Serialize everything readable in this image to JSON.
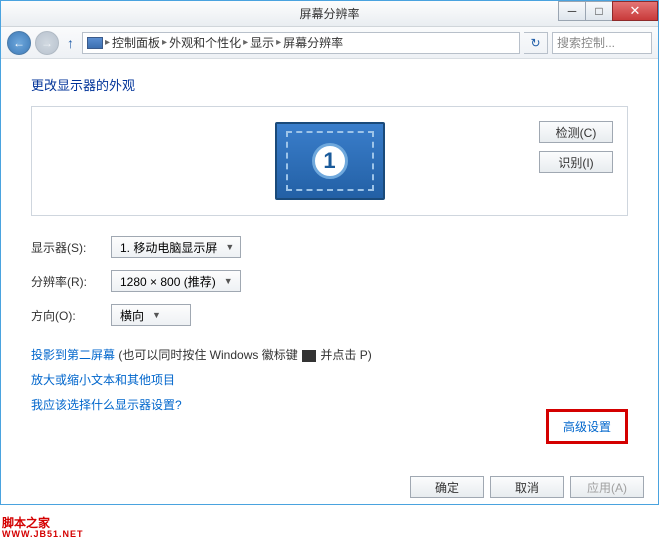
{
  "window": {
    "title": "屏幕分辨率",
    "min_icon": "─",
    "max_icon": "□",
    "close_icon": "✕"
  },
  "nav": {
    "back": "←",
    "forward": "→",
    "up": "↑",
    "refresh": "↻",
    "crumbs": [
      "控制面板",
      "外观和个性化",
      "显示",
      "屏幕分辨率"
    ],
    "sep": "▸",
    "search_placeholder": "搜索控制..."
  },
  "page": {
    "heading": "更改显示器的外观",
    "monitor_number": "1",
    "detect_btn": "检测(C)",
    "identify_btn": "识别(I)",
    "labels": {
      "display": "显示器(S):",
      "resolution": "分辨率(R):",
      "orientation": "方向(O):"
    },
    "values": {
      "display": "1. 移动电脑显示屏",
      "resolution": "1280 × 800 (推荐)",
      "orientation": "横向"
    },
    "advanced": "高级设置",
    "links": {
      "project_prefix": "投影到第二屏幕",
      "project_suffix": " (也可以同时按住 Windows 徽标键 ",
      "project_tail": " 并点击 P)",
      "textsize": "放大或缩小文本和其他项目",
      "which": "我应该选择什么显示器设置?"
    },
    "buttons": {
      "ok": "确定",
      "cancel": "取消",
      "apply": "应用(A)"
    }
  },
  "watermark": {
    "line1": "脚本之家",
    "line2": "WWW.JB51.NET"
  }
}
